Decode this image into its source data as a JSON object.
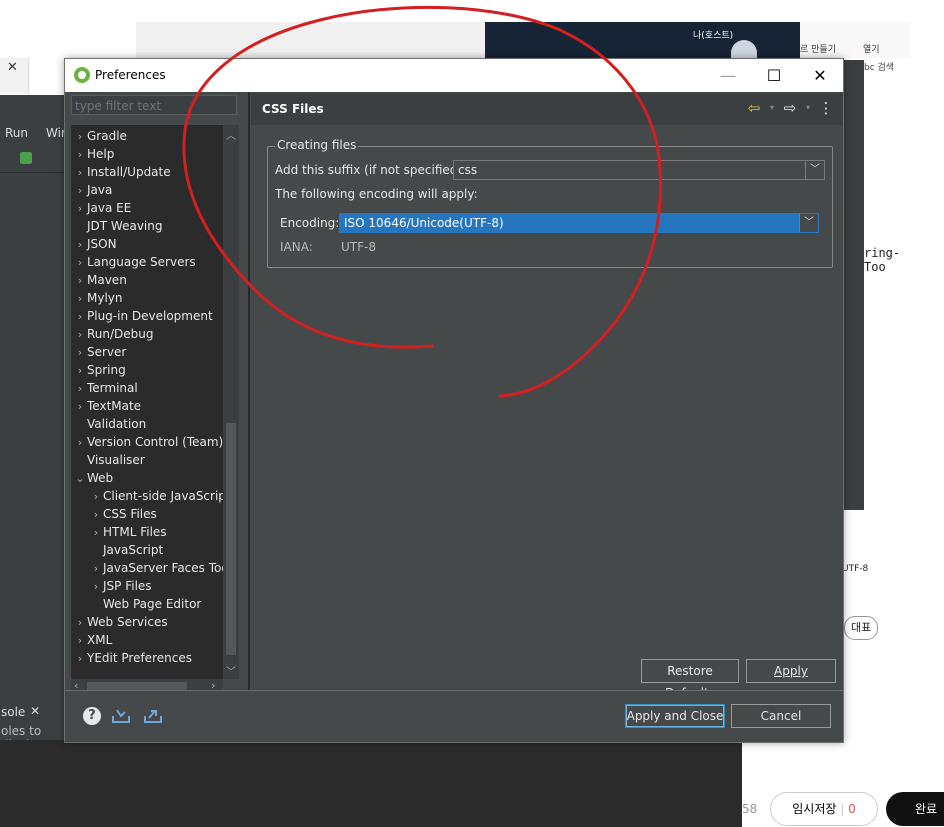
{
  "dialog": {
    "title": "Preferences",
    "filter_placeholder": "type filter text",
    "page_title": "CSS Files",
    "tree": [
      {
        "label": "Gradle",
        "indent": 0,
        "expander": "›"
      },
      {
        "label": "Help",
        "indent": 0,
        "expander": "›"
      },
      {
        "label": "Install/Update",
        "indent": 0,
        "expander": "›"
      },
      {
        "label": "Java",
        "indent": 0,
        "expander": "›"
      },
      {
        "label": "Java EE",
        "indent": 0,
        "expander": "›"
      },
      {
        "label": "JDT Weaving",
        "indent": 0,
        "expander": ""
      },
      {
        "label": "JSON",
        "indent": 0,
        "expander": "›"
      },
      {
        "label": "Language Servers",
        "indent": 0,
        "expander": "›"
      },
      {
        "label": "Maven",
        "indent": 0,
        "expander": "›"
      },
      {
        "label": "Mylyn",
        "indent": 0,
        "expander": "›"
      },
      {
        "label": "Plug-in Development",
        "indent": 0,
        "expander": "›"
      },
      {
        "label": "Run/Debug",
        "indent": 0,
        "expander": "›"
      },
      {
        "label": "Server",
        "indent": 0,
        "expander": "›"
      },
      {
        "label": "Spring",
        "indent": 0,
        "expander": "›"
      },
      {
        "label": "Terminal",
        "indent": 0,
        "expander": "›"
      },
      {
        "label": "TextMate",
        "indent": 0,
        "expander": "›"
      },
      {
        "label": "Validation",
        "indent": 0,
        "expander": ""
      },
      {
        "label": "Version Control (Team)",
        "indent": 0,
        "expander": "›"
      },
      {
        "label": "Visualiser",
        "indent": 0,
        "expander": ""
      },
      {
        "label": "Web",
        "indent": 0,
        "expander": "⌄"
      },
      {
        "label": "Client-side JavaScript",
        "indent": 1,
        "expander": "›"
      },
      {
        "label": "CSS Files",
        "indent": 1,
        "expander": "›"
      },
      {
        "label": "HTML Files",
        "indent": 1,
        "expander": "›"
      },
      {
        "label": "JavaScript",
        "indent": 1,
        "expander": ""
      },
      {
        "label": "JavaServer Faces Tools",
        "indent": 1,
        "expander": "›"
      },
      {
        "label": "JSP Files",
        "indent": 1,
        "expander": "›"
      },
      {
        "label": "Web Page Editor",
        "indent": 1,
        "expander": ""
      },
      {
        "label": "Web Services",
        "indent": 0,
        "expander": "›"
      },
      {
        "label": "XML",
        "indent": 0,
        "expander": "›"
      },
      {
        "label": "YEdit Preferences",
        "indent": 0,
        "expander": "›"
      }
    ],
    "group_label": "Creating files",
    "suffix_label": "Add this suffix (if not specified):",
    "suffix_value": "css",
    "encoding_note": "The following encoding will apply:",
    "encoding_label": "Encoding:",
    "encoding_value": "ISO 10646/Unicode(UTF-8)",
    "iana_label": "IANA:",
    "iana_value": "UTF-8",
    "restore_defaults": "Restore Defaults",
    "apply": "Apply",
    "apply_and_close": "Apply and Close",
    "cancel": "Cancel"
  },
  "background": {
    "menu_run": "Run",
    "menu_win": "Wir",
    "console_tab": "sole",
    "console_text": "oles to displ",
    "right_code": "ring-Too",
    "right_utf": "UTF-8",
    "search_text": "bc 검색",
    "thumb_name": "나(호스트)",
    "make_label": "르 만들기",
    "open_label": "열기",
    "badge_label": "대표",
    "draft_save": "임시저장",
    "draft_count": "0",
    "done_button": "완료",
    "count_fragment": "58"
  },
  "colors": {
    "annotation_stroke": "#d31f1f",
    "selection": "#2675bf",
    "dialog_bg": "#45494a"
  }
}
